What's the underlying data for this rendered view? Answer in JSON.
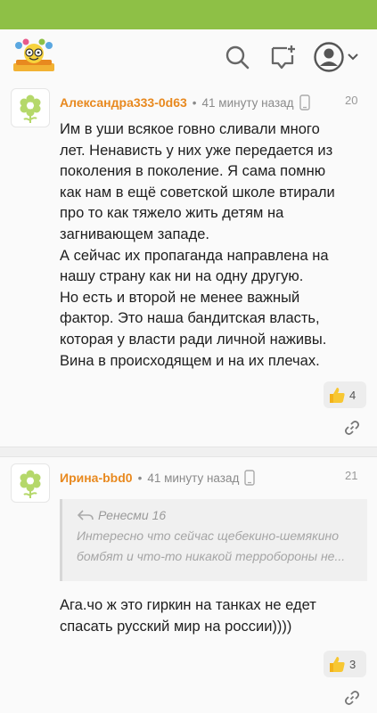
{
  "header": {
    "logo": "smiley-books-logo",
    "icons": [
      "search-icon",
      "new-comment-icon",
      "user-avatar-icon",
      "chevron-down-icon"
    ]
  },
  "comments": [
    {
      "author": "Александра333-0d63",
      "separator": "•",
      "time": "41 минуту назад",
      "number": "20",
      "lines": [
        "Им в уши всякое говно сливали много",
        "лет. Ненависть у них уже передается из",
        "поколения в поколение. Я сама помню",
        "как нам в ещё советской школе втирали",
        "про то как тяжело жить детям на",
        "загнивающем западе.",
        "А сейчас их пропаганда направлена на",
        "нашу страну как ни на одну другую.",
        "Но есть и второй не менее важный",
        "фактор. Это наша бандитская власть,",
        "которая у власти ради личной наживы.",
        "Вина в происходящем и на их плечах."
      ],
      "likes": "4"
    },
    {
      "author": "Ирина-bbd0",
      "separator": "•",
      "time": "41 минуту назад",
      "number": "21",
      "quote": {
        "author": "Ренесми 16",
        "lines": [
          "Интересно  что  сейчас  щебекино-шемякино",
          "бомбят  и  что-то  никакой  терробороны  не..."
        ]
      },
      "lines": [
        "Ага.чо ж это гиркин на танках не едет",
        "спасать русский мир на россии))))"
      ],
      "likes": "3"
    }
  ],
  "colors": {
    "topbar": "#8ec046",
    "author": "#e8891f",
    "avatar_flower": "#b5d86a"
  }
}
